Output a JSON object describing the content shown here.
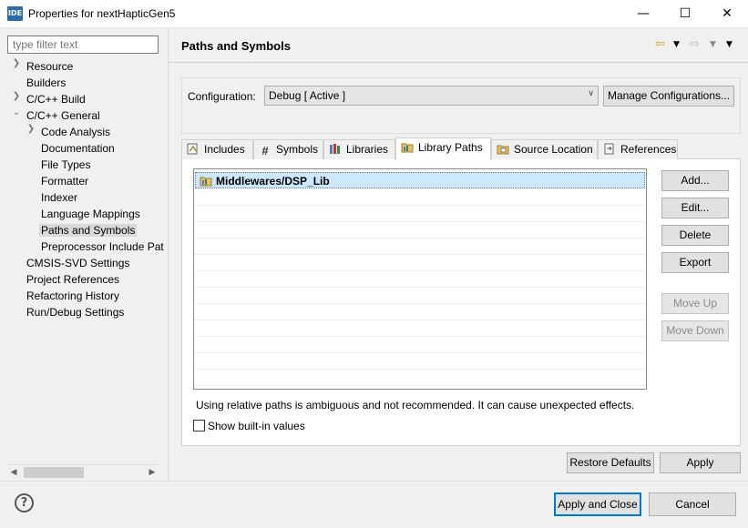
{
  "window": {
    "icon_text": "IDE",
    "title": "Properties for nextHapticGen5",
    "minimize": "—",
    "maximize": "☐",
    "close": "✕"
  },
  "filter": {
    "placeholder": "type filter text"
  },
  "tree": {
    "resource": "Resource",
    "builders": "Builders",
    "cc_build": "C/C++ Build",
    "cc_general": "C/C++ General",
    "code_analysis": "Code Analysis",
    "documentation": "Documentation",
    "file_types": "File Types",
    "formatter": "Formatter",
    "indexer": "Indexer",
    "language_mappings": "Language Mappings",
    "paths_and_symbols": "Paths and Symbols",
    "preprocessor": "Preprocessor Include Pat",
    "cmsis_svd": "CMSIS-SVD Settings",
    "project_references": "Project References",
    "refactoring_history": "Refactoring History",
    "run_debug": "Run/Debug Settings"
  },
  "page": {
    "title": "Paths and Symbols"
  },
  "configuration": {
    "label": "Configuration:",
    "value": "Debug  [ Active ]",
    "manage_button": "Manage Configurations..."
  },
  "tabs": {
    "includes": "Includes",
    "symbols": "Symbols",
    "libraries": "Libraries",
    "library_paths": "Library Paths",
    "source_location": "Source Location",
    "references": "References"
  },
  "library_paths": {
    "items": [
      "Middlewares/DSP_Lib"
    ]
  },
  "buttons": {
    "add": "Add...",
    "edit": "Edit...",
    "delete": "Delete",
    "export": "Export",
    "move_up": "Move Up",
    "move_down": "Move Down",
    "restore_defaults": "Restore Defaults",
    "apply": "Apply",
    "apply_close": "Apply and Close",
    "cancel": "Cancel"
  },
  "warning": "Using relative paths is ambiguous and not recommended. It can cause unexpected effects.",
  "show_builtin": {
    "label": "Show built-in values",
    "checked": false
  },
  "help": "?"
}
